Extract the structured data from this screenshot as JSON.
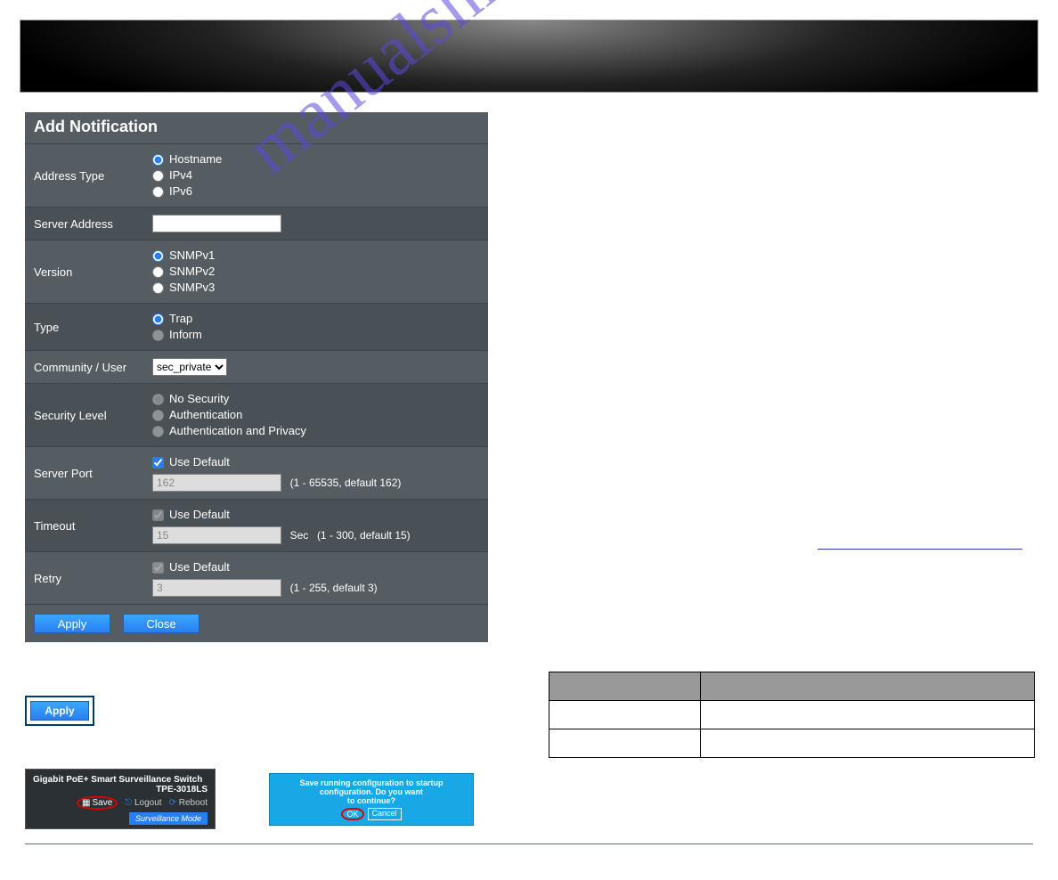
{
  "watermark": "manualshive.com",
  "panel": {
    "title": "Add Notification",
    "address_type": {
      "label": "Address Type",
      "options": [
        "Hostname",
        "IPv4",
        "IPv6"
      ],
      "selected": 0
    },
    "server_address": {
      "label": "Server Address",
      "value": ""
    },
    "version": {
      "label": "Version",
      "options": [
        "SNMPv1",
        "SNMPv2",
        "SNMPv3"
      ],
      "selected": 0
    },
    "type": {
      "label": "Type",
      "options": [
        "Trap",
        "Inform"
      ],
      "selected": 0,
      "disabled_index": 1
    },
    "community_user": {
      "label": "Community / User",
      "options": [
        "sec_private"
      ],
      "selected": "sec_private"
    },
    "security_level": {
      "label": "Security Level",
      "options": [
        "No Security",
        "Authentication",
        "Authentication and Privacy"
      ],
      "selected": 0,
      "disabled": true
    },
    "server_port": {
      "label": "Server Port",
      "use_default_label": "Use Default",
      "use_default": true,
      "value": "162",
      "hint": "(1 - 65535, default 162)"
    },
    "timeout": {
      "label": "Timeout",
      "use_default_label": "Use Default",
      "use_default": true,
      "disabled": true,
      "value": "15",
      "unit": "Sec",
      "hint": "(1 - 300, default 15)"
    },
    "retry": {
      "label": "Retry",
      "use_default_label": "Use Default",
      "use_default": true,
      "disabled": true,
      "value": "3",
      "hint": "(1 - 255, default 3)"
    },
    "buttons": {
      "apply": "Apply",
      "close": "Close"
    }
  },
  "standalone_apply": "Apply",
  "mini1": {
    "line1": "Gigabit PoE+ Smart Surveillance Switch",
    "line2": "TPE-3018LS",
    "save": "Save",
    "logout": "Logout",
    "reboot": "Reboot",
    "surv": "Surveillance Mode"
  },
  "mini2": {
    "line1": "Save running configuration to startup configuration. Do you want",
    "line2": "to continue?",
    "ok": "OK",
    "cancel": "Cancel"
  },
  "right_table": {
    "headers": [
      "",
      ""
    ],
    "rows": [
      [
        "",
        ""
      ],
      [
        "",
        ""
      ]
    ]
  }
}
